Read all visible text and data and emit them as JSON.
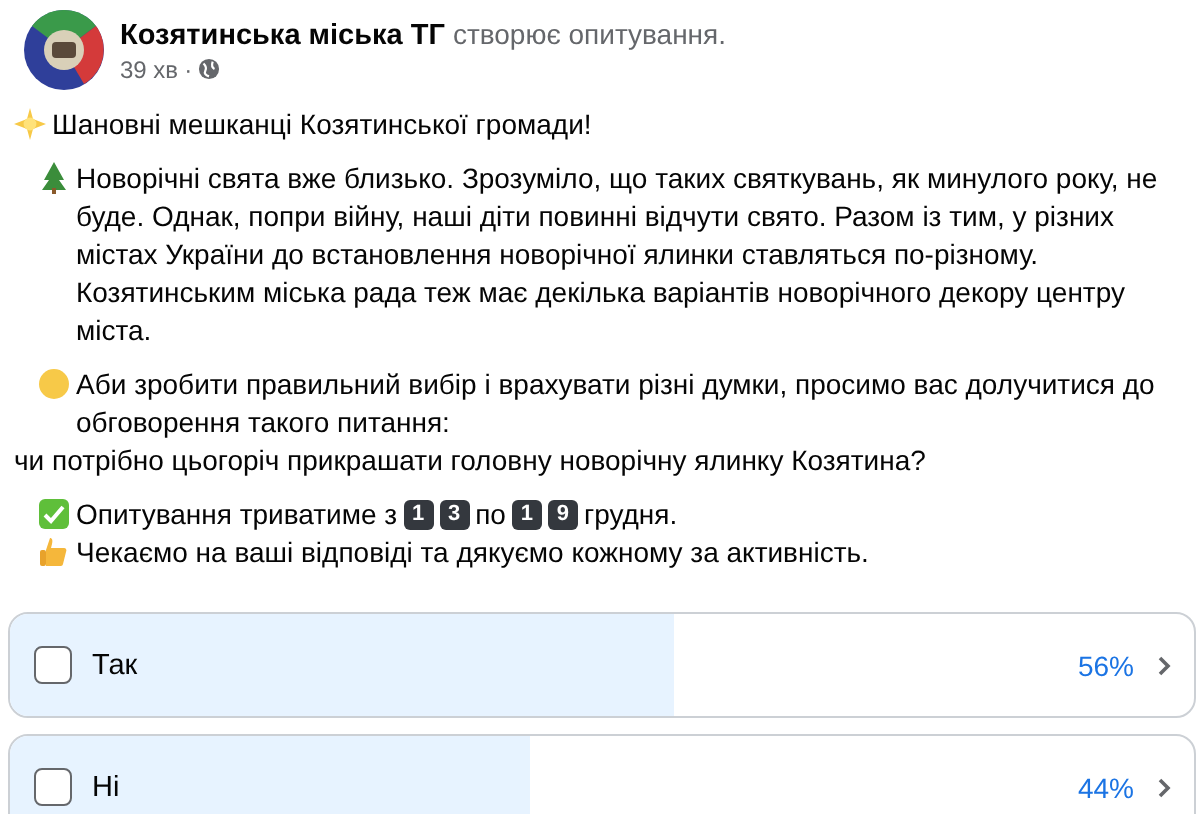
{
  "post": {
    "author": "Козятинська міська ТГ",
    "action": "створює опитування.",
    "time": "39 хв",
    "separator": "·"
  },
  "paragraphs": [
    {
      "lines": [
        [
          {
            "kind": "icon"
          },
          {
            "kind": "text",
            "text": "Шановні мешканці Козятинської громади!"
          }
        ]
      ]
    },
    {
      "lines": [
        [
          {
            "kind": "indent"
          },
          {
            "kind": "icon"
          },
          {
            "kind": "text",
            "text": "Новорічні свята вже близько. Зрозуміло, що таких святкувань, як минулого року, не буде. Однак, попри війну, наші діти повинні відчути свято. Разом із тим, у різних містах України до встановлення новорічної ялинки ставляться по-різному. Козятинським міська рада теж має декілька варіантів новорічного декору центру міста."
          }
        ]
      ]
    },
    {
      "lines": [
        [
          {
            "kind": "indent"
          },
          {
            "kind": "icon"
          },
          {
            "kind": "text",
            "text": "Аби зробити правильний вибір і врахувати різні думки, просимо вас долучитися до обговорення такого питання:"
          }
        ],
        [
          {
            "kind": "text",
            "text": "чи потрібно цьогоріч прикрашати головну новорічну ялинку Козятина?"
          }
        ]
      ]
    },
    {
      "lines": [
        [
          {
            "kind": "indent"
          },
          {
            "kind": "icon"
          },
          {
            "kind": "text",
            "text": "Опитування триватиме з"
          },
          {
            "kind": "keycap",
            "text": "1"
          },
          {
            "kind": "keycap",
            "text": "3"
          },
          {
            "kind": "text",
            "text": "по"
          },
          {
            "kind": "keycap",
            "text": "1"
          },
          {
            "kind": "keycap",
            "text": "9"
          },
          {
            "kind": "text",
            "text": "грудня."
          }
        ],
        [
          {
            "kind": "indent"
          },
          {
            "kind": "icon"
          },
          {
            "kind": "text",
            "text": "Чекаємо на ваші відповіді та дякуємо кожному за активність."
          }
        ]
      ]
    }
  ],
  "poll": [
    {
      "label": "Так",
      "percent": "56%",
      "level": 0.56,
      "checked": false
    },
    {
      "label": "Ні",
      "percent": "44%",
      "level": 0.44,
      "checked": false
    }
  ]
}
